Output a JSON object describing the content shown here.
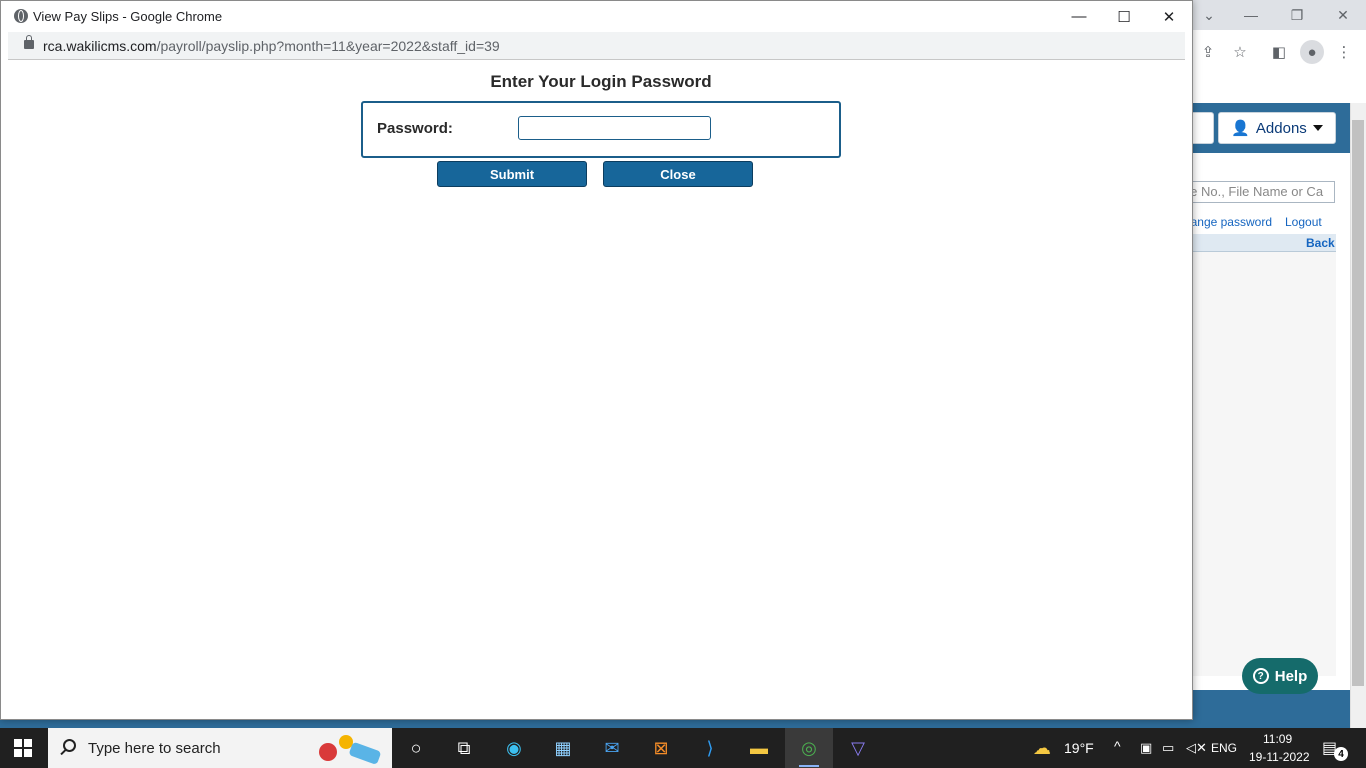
{
  "popup": {
    "window_title": "View Pay Slips - Google Chrome",
    "url_host": "rca.wakilicms.com",
    "url_path": "/payroll/payslip.php?month=11&year=2022&staff_id=39",
    "minimize": "—",
    "maximize": "☐",
    "close": "✕"
  },
  "login": {
    "heading": "Enter Your Login Password",
    "password_label": "Password:",
    "password_value": "",
    "submit_label": "Submit",
    "close_label": "Close"
  },
  "background": {
    "addons_label": "Addons",
    "search_placeholder": "Case No., File Name or Ca",
    "change_password_link": "Change password",
    "logout_link": "Logout",
    "back_link": "Back",
    "help_label": "Help"
  },
  "taskbar": {
    "search_placeholder": "Type here to search",
    "weather": "19°F",
    "language": "ENG",
    "time": "11:09",
    "date": "19-11-2022",
    "notification_count": "4"
  },
  "colors": {
    "header_blue": "#2e6c99",
    "button_blue": "#17669a",
    "help_teal": "#156b6b"
  }
}
